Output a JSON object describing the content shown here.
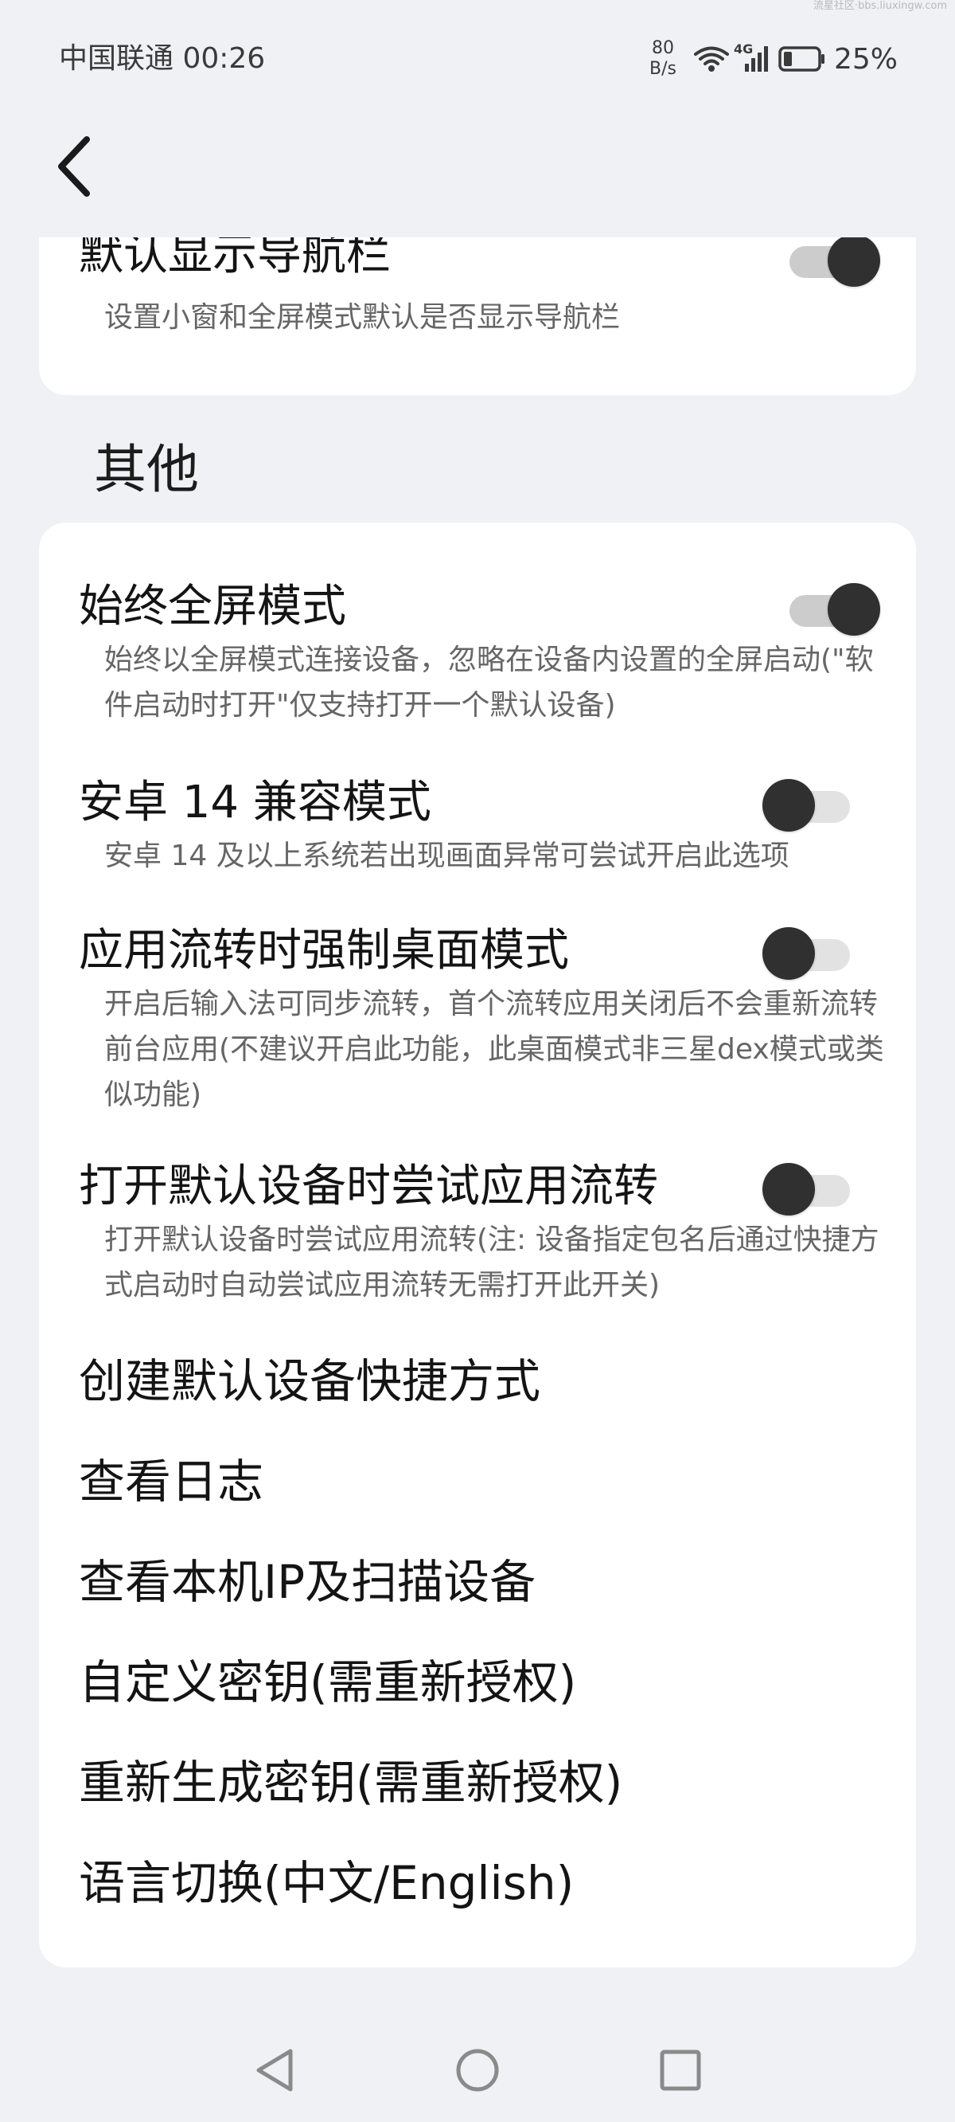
{
  "watermark": "流星社区·bbs.liuxingw.com",
  "status_bar": {
    "carrier": "中国联通",
    "time": "00:26",
    "net_speed_value": "80",
    "net_speed_unit": "B/s",
    "signal_label": "4G",
    "battery": "25%",
    "battery_level": 0.25,
    "icons": [
      "wifi-icon",
      "signal-icon",
      "battery-icon"
    ]
  },
  "header": {
    "back_icon": "chevron-left-icon"
  },
  "top_setting": {
    "title": "默认显示导航栏",
    "desc": "设置小窗和全屏模式默认是否显示导航栏",
    "enabled": true
  },
  "section_other": {
    "title": "其他",
    "toggles": [
      {
        "title": "始终全屏模式",
        "desc": "始终以全屏模式连接设备，忽略在设备内设置的全屏启动(\"软件启动时打开\"仅支持打开一个默认设备)",
        "enabled": true
      },
      {
        "title": "安卓 14 兼容模式",
        "desc": "安卓 14 及以上系统若出现画面异常可尝试开启此选项",
        "enabled": false
      },
      {
        "title": "应用流转时强制桌面模式",
        "desc": "开启后输入法可同步流转，首个流转应用关闭后不会重新流转前台应用(不建议开启此功能，此桌面模式非三星dex模式或类似功能)",
        "enabled": false
      },
      {
        "title": "打开默认设备时尝试应用流转",
        "desc": "打开默认设备时尝试应用流转(注: 设备指定包名后通过快捷方式启动时自动尝试应用流转无需打开此开关)",
        "enabled": false
      }
    ],
    "links": [
      "创建默认设备快捷方式",
      "查看日志",
      "查看本机IP及扫描设备",
      "自定义密钥(需重新授权)",
      "重新生成密钥(需重新授权)",
      "语言切换(中文/English)"
    ]
  },
  "nav_bar": {
    "icons": [
      "back-triangle-icon",
      "home-circle-icon",
      "recents-square-icon"
    ],
    "color": "#8a8a8a"
  }
}
